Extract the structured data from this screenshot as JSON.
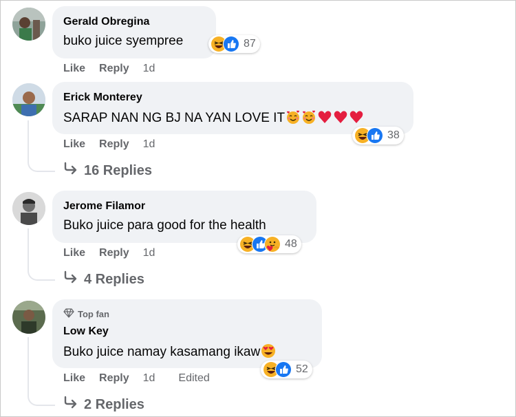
{
  "comments": [
    {
      "author": "Gerald Obregina",
      "text": "buko juice syempree",
      "top_fan": "",
      "reaction_count": "87",
      "actions": {
        "like": "Like",
        "reply": "Reply",
        "time": "1d",
        "edited": ""
      },
      "replies_label": ""
    },
    {
      "author": "Erick Monterey",
      "text": "SARAP NAN NG BJ NA YAN LOVE IT",
      "top_fan": "",
      "reaction_count": "38",
      "actions": {
        "like": "Like",
        "reply": "Reply",
        "time": "1d",
        "edited": ""
      },
      "replies_label": "16 Replies"
    },
    {
      "author": "Jerome Filamor",
      "text": "Buko juice para good for the health",
      "top_fan": "",
      "reaction_count": "48",
      "actions": {
        "like": "Like",
        "reply": "Reply",
        "time": "1d",
        "edited": ""
      },
      "replies_label": "4 Replies"
    },
    {
      "author": "Low Key",
      "text": "Buko juice namay kasamang ikaw",
      "top_fan": "Top fan",
      "reaction_count": "52",
      "actions": {
        "like": "Like",
        "reply": "Reply",
        "time": "1d",
        "edited": "Edited"
      },
      "replies_label": "2 Replies"
    }
  ],
  "colors": {
    "bubble": "#f0f2f5",
    "secondary_text": "#65676b",
    "like_blue": "#1877f2",
    "haha_yellow": "#f7b125",
    "heart_red": "#e41e3f"
  },
  "icons": [
    "haha-reaction-icon",
    "like-reaction-icon",
    "care-reaction-icon",
    "smiling-hearts-emoji-icon",
    "red-heart-emoji-icon",
    "heart-eyes-emoji-icon",
    "diamond-icon",
    "reply-arrow-icon"
  ]
}
